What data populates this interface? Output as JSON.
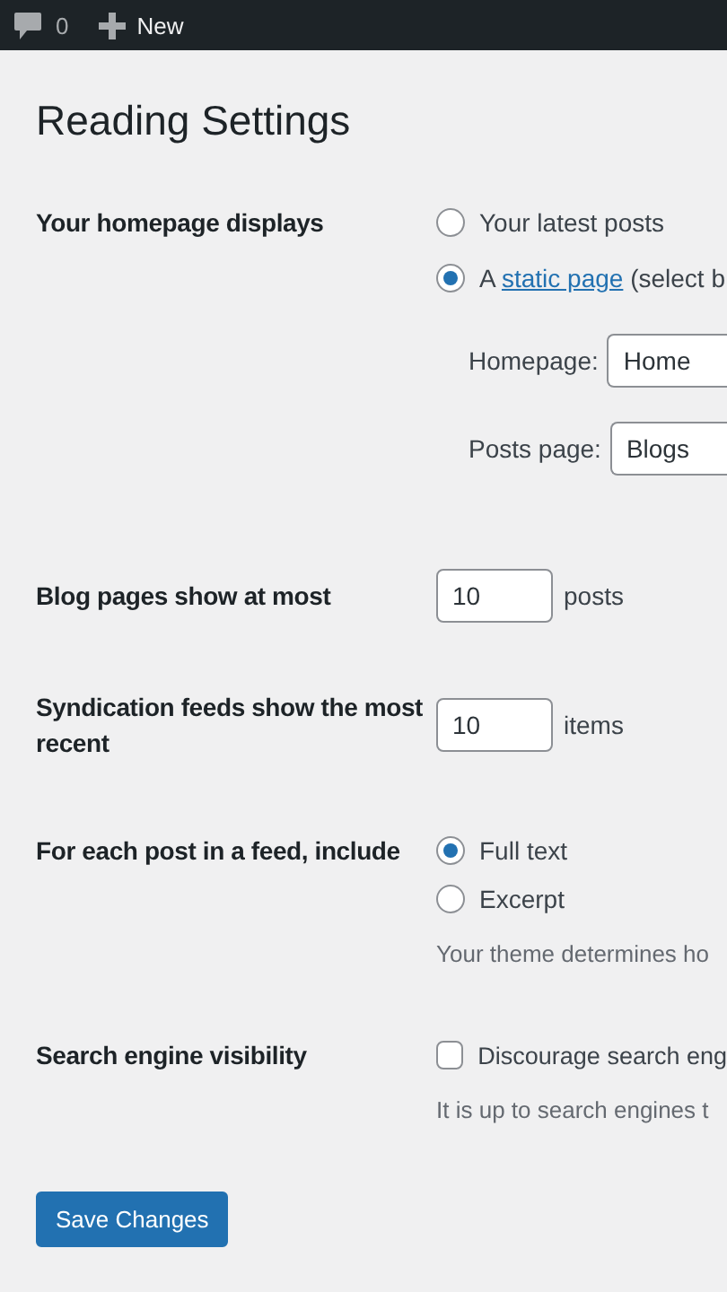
{
  "admin_bar": {
    "comments_count": "0",
    "new_label": "New"
  },
  "title": "Reading Settings",
  "settings": [
    {
      "kind": "homepage",
      "label": "Your homepage displays",
      "options": [
        {
          "kind": "plain",
          "text": "Your latest posts",
          "selected": false
        },
        {
          "kind": "link",
          "prefix": "A ",
          "link": "static page",
          "suffix": " (select b",
          "selected": true
        }
      ],
      "selects": [
        {
          "label": "Homepage:",
          "value": "Home"
        },
        {
          "label": "Posts page:",
          "value": "Blogs"
        }
      ]
    },
    {
      "kind": "number",
      "label": "Blog pages show at most",
      "value": "10",
      "unit": "posts"
    },
    {
      "kind": "number",
      "label": "Syndication feeds show the most recent",
      "value": "10",
      "unit": "items"
    },
    {
      "kind": "radio",
      "label": "For each post in a feed, include",
      "options": [
        {
          "kind": "plain",
          "text": "Full text",
          "selected": true
        },
        {
          "kind": "plain",
          "text": "Excerpt",
          "selected": false
        }
      ],
      "description": "Your theme determines ho"
    },
    {
      "kind": "checkbox",
      "label": "Search engine visibility",
      "text": "Discourage search eng",
      "checked": false,
      "description": "It is up to search engines t"
    }
  ],
  "save_button": "Save Changes"
}
